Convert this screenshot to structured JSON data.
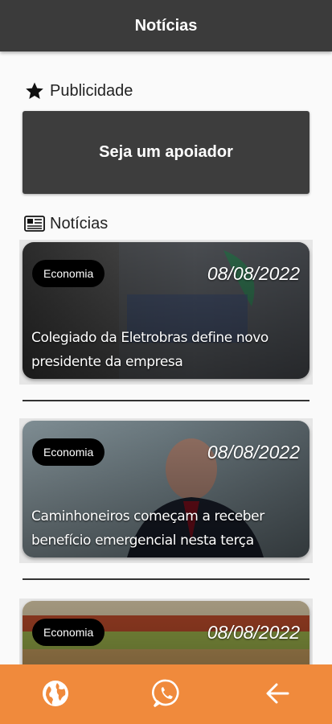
{
  "header": {
    "title": "Notícias"
  },
  "ad_section": {
    "label": "Publicidade",
    "icon": "star-icon",
    "button_label": "Seja um apoiador"
  },
  "news_section": {
    "label": "Notícias",
    "icon": "newspaper-icon"
  },
  "articles": [
    {
      "category": "Economia",
      "date": "08/08/2022",
      "title": "Colegiado da Eletrobras define novo presidente da empresa"
    },
    {
      "category": "Economia",
      "date": "08/08/2022",
      "title": "Caminhoneiros começam a receber benefício emergencial nesta terça"
    },
    {
      "category": "Economia",
      "date": "08/08/2022",
      "title": ""
    }
  ],
  "bottom_nav": [
    {
      "icon": "globe-icon"
    },
    {
      "icon": "whatsapp-icon"
    },
    {
      "icon": "back-arrow-icon"
    }
  ],
  "colors": {
    "topbar": "#3b3b3b",
    "bottombar": "#f08a3c",
    "ad_box": "#3d3d3d"
  }
}
